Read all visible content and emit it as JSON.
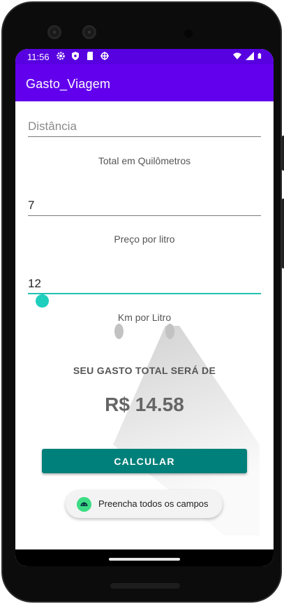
{
  "status_bar": {
    "time": "11:56",
    "left_icons": [
      "gear-icon",
      "shield-icon",
      "sd-card-icon",
      "android-debug-icon"
    ],
    "right_icons": [
      "wifi-icon",
      "signal-icon",
      "battery-icon"
    ]
  },
  "app_bar": {
    "title": "Gasto_Viagem"
  },
  "form": {
    "distance": {
      "value": "",
      "placeholder": "Distância",
      "caption": "Total em Quilômetros"
    },
    "price": {
      "value": "7",
      "caption": "Preço por litro"
    },
    "km_per_liter": {
      "value": "12",
      "caption": "Km por Litro"
    }
  },
  "result": {
    "label": "SEU GASTO TOTAL SERÁ DE",
    "value": "R$ 14.58"
  },
  "calculate_button": {
    "label": "CALCULAR"
  },
  "toast": {
    "text": "Preencha todos os campos",
    "icon": "android-icon"
  },
  "colors": {
    "app_bar": "#6200ee",
    "status_bar": "#5700e0",
    "accent": "#1fcfbd",
    "button": "#00807a"
  }
}
